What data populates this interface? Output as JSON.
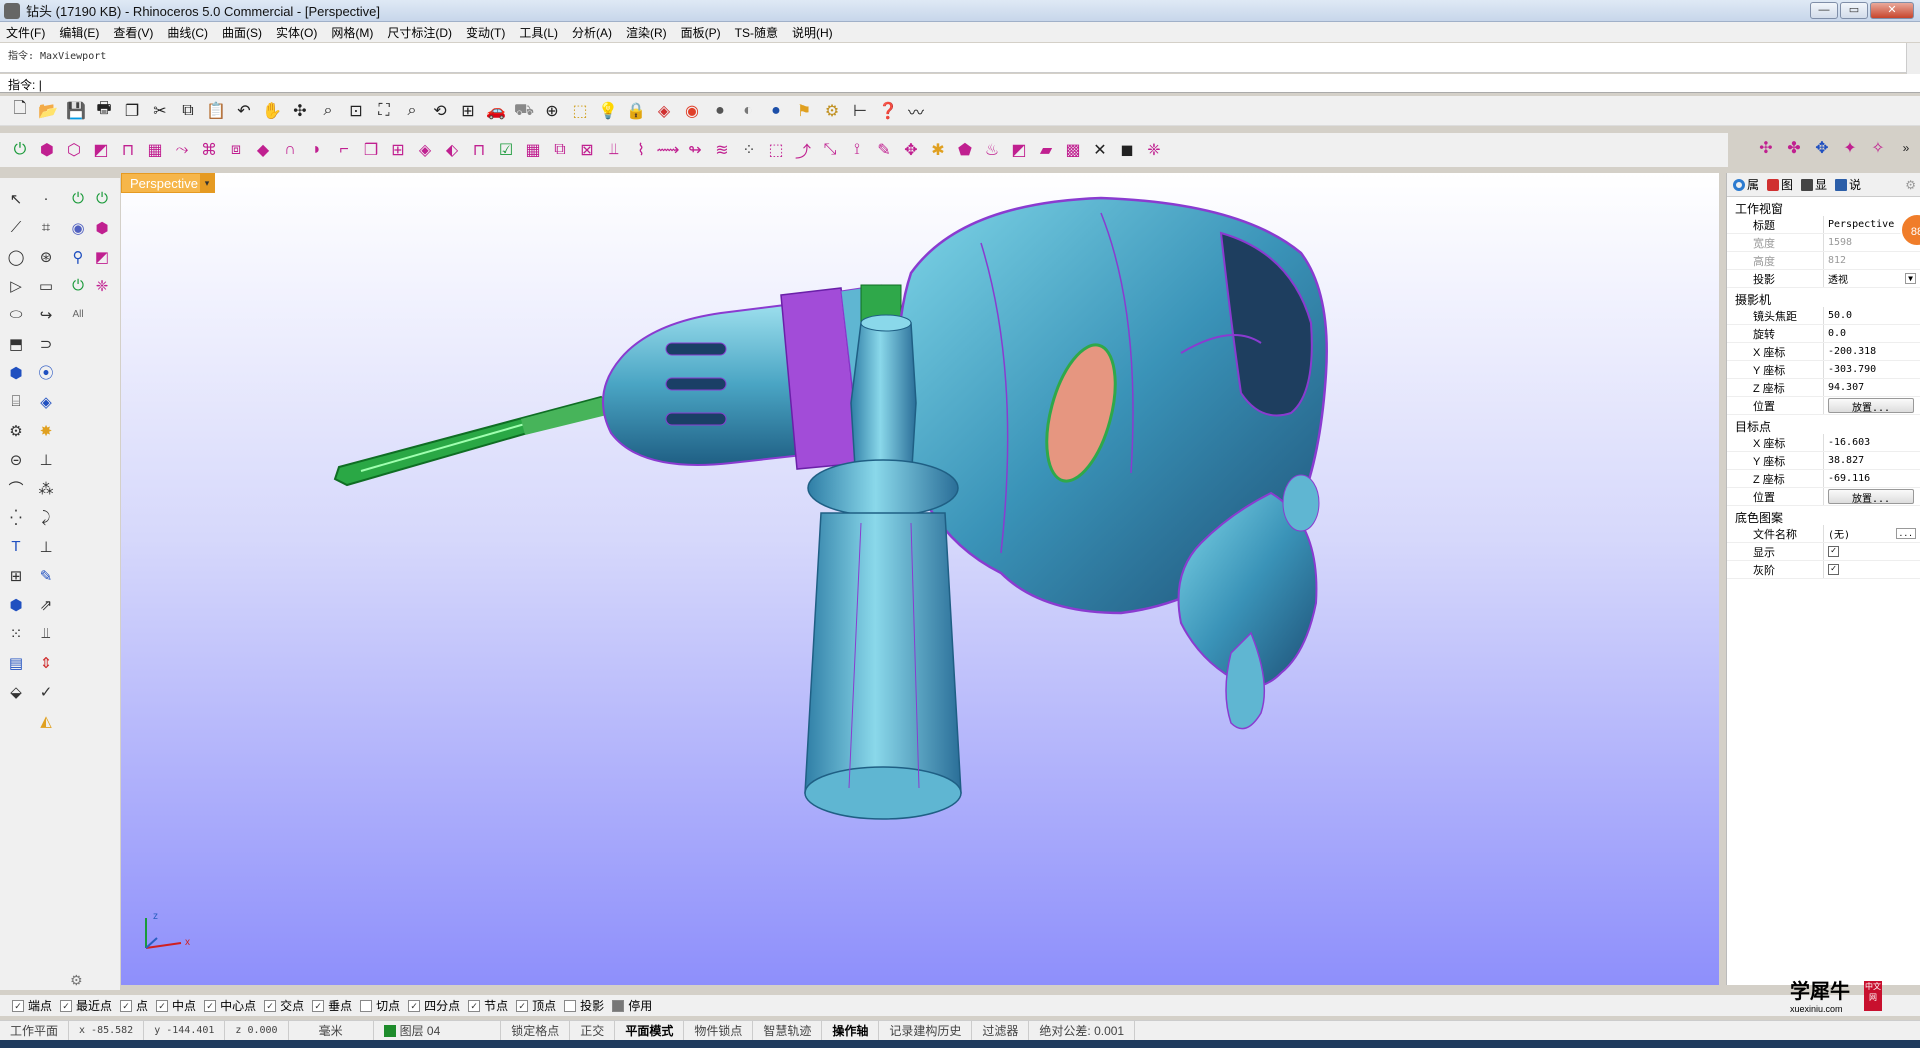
{
  "window": {
    "title": "钻头 (17190 KB) - Rhinoceros 5.0 Commercial - [Perspective]",
    "minimize": "—",
    "maximize": "▭",
    "close": "✕"
  },
  "menu": [
    "文件(F)",
    "编辑(E)",
    "查看(V)",
    "曲线(C)",
    "曲面(S)",
    "实体(O)",
    "网格(M)",
    "尺寸标注(D)",
    "变动(T)",
    "工具(L)",
    "分析(A)",
    "渲染(R)",
    "面板(P)",
    "TS-随意",
    "说明(H)"
  ],
  "command": {
    "history": "指令: MaxViewport",
    "prompt": "指令:",
    "value": ""
  },
  "viewport": {
    "tab_label": "Perspective",
    "axis_z": "z",
    "axis_x": "x"
  },
  "left_toggle_label": "All",
  "right_panel": {
    "tabs": [
      {
        "label": "属",
        "color": "#2c7bd0"
      },
      {
        "label": "图",
        "color": "#d03030"
      },
      {
        "label": "显",
        "color": "#444444"
      },
      {
        "label": "说",
        "color": "#2c5ea8"
      }
    ],
    "badge": "88",
    "section_viewport": "工作视窗",
    "section_camera": "摄影机",
    "section_target": "目标点",
    "section_wallpaper": "底色图案",
    "title_label": "标题",
    "title_value": "Perspective",
    "width_label": "宽度",
    "width_value": "1598",
    "height_label": "高度",
    "height_value": "812",
    "projection_label": "投影",
    "projection_value": "透视",
    "lens_label": "镜头焦距",
    "lens_value": "50.0",
    "rotation_label": "旋转",
    "rotation_value": "0.0",
    "cam_x_label": "X 座标",
    "cam_x_value": "-200.318",
    "cam_y_label": "Y 座标",
    "cam_y_value": "-303.790",
    "cam_z_label": "Z 座标",
    "cam_z_value": "94.307",
    "cam_pos_label": "位置",
    "place_button": "放置...",
    "tgt_x_label": "X 座标",
    "tgt_x_value": "-16.603",
    "tgt_y_label": "Y 座标",
    "tgt_y_value": "38.827",
    "tgt_z_label": "Z 座标",
    "tgt_z_value": "-69.116",
    "tgt_pos_label": "位置",
    "file_label": "文件名称",
    "file_value": "(无)",
    "show_label": "显示",
    "gray_label": "灰阶"
  },
  "osnap": [
    {
      "label": "端点",
      "checked": true
    },
    {
      "label": "最近点",
      "checked": true
    },
    {
      "label": "点",
      "checked": true
    },
    {
      "label": "中点",
      "checked": true
    },
    {
      "label": "中心点",
      "checked": true
    },
    {
      "label": "交点",
      "checked": true
    },
    {
      "label": "垂点",
      "checked": true
    },
    {
      "label": "切点",
      "checked": false
    },
    {
      "label": "四分点",
      "checked": true
    },
    {
      "label": "节点",
      "checked": true
    },
    {
      "label": "顶点",
      "checked": true
    },
    {
      "label": "投影",
      "checked": false
    },
    {
      "label": "停用",
      "checked": false
    }
  ],
  "status": {
    "cplane": "工作平面",
    "x": "x -85.582",
    "y": "y -144.401",
    "z": "z 0.000",
    "units": "毫米",
    "layer": "图层 04",
    "grid_snap": "锁定格点",
    "ortho": "正交",
    "planar": "平面模式",
    "osnap": "物件锁点",
    "smarttrack": "智慧轨迹",
    "gumball": "操作轴",
    "history": "记录建构历史",
    "filter": "过滤器",
    "tolerance": "绝对公差: 0.001"
  },
  "watermark": {
    "big": "学犀牛",
    "small": "xuexiniu.com",
    "side": "中文网"
  }
}
